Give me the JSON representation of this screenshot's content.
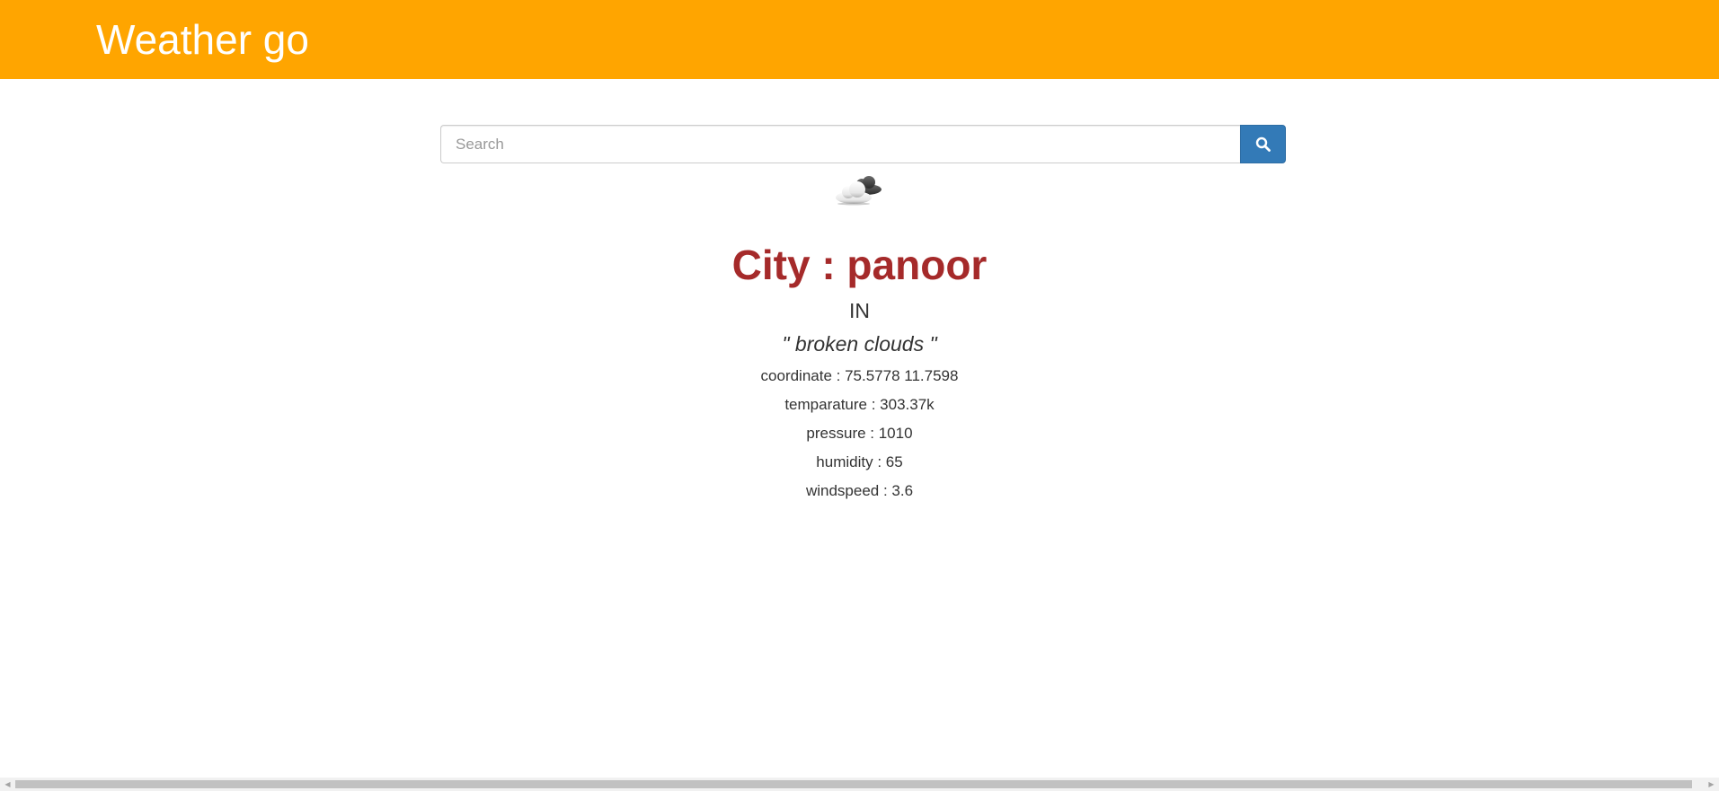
{
  "header": {
    "brand": "Weather go",
    "background_color": "#ffa500"
  },
  "search": {
    "placeholder": "Search",
    "value": "",
    "button_icon": "search-icon",
    "button_color": "#337ab7"
  },
  "weather": {
    "icon": "broken-clouds-icon",
    "city_line": "City : panoor",
    "country": "IN",
    "description": "\" broken clouds \"",
    "stats": [
      "coordinate : 75.5778 11.7598",
      "temparature : 303.37k",
      "pressure : 1010",
      "humidity : 65",
      "windspeed : 3.6"
    ],
    "city_color": "#a52a2a"
  },
  "scrollbar": {
    "left_arrow": "scroll-left-arrow-icon",
    "right_arrow": "scroll-right-arrow-icon"
  }
}
